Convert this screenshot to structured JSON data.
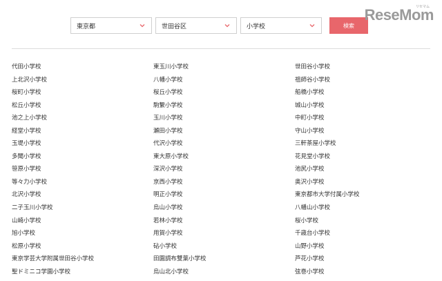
{
  "filters": {
    "prefecture": "東京都",
    "city": "世田谷区",
    "school_type": "小学校",
    "search_label": "検索"
  },
  "logo": {
    "text": "ReseMom",
    "ruby": "リセマム"
  },
  "columns": [
    [
      "代田小学校",
      "上北沢小学校",
      "桜町小学校",
      "松丘小学校",
      "池之上小学校",
      "経堂小学校",
      "玉堤小学校",
      "多聞小学校",
      "笹原小学校",
      "等々力小学校",
      "北沢小学校",
      "二子玉川小学校",
      "山崎小学校",
      "旭小学校",
      "松原小学校",
      "東京学芸大学附属世田谷小学校",
      "聖ドミニコ学園小学校"
    ],
    [
      "東玉川小学校",
      "八幡小学校",
      "桜丘小学校",
      "駒繋小学校",
      "玉川小学校",
      "瀬田小学校",
      "代沢小学校",
      "東大原小学校",
      "深沢小学校",
      "京西小学校",
      "明正小学校",
      "烏山小学校",
      "若林小学校",
      "用賀小学校",
      "砧小学校",
      "田園調布雙葉小学校",
      "烏山北小学校"
    ],
    [
      "世田谷小学校",
      "祖師谷小学校",
      "船橋小学校",
      "城山小学校",
      "中町小学校",
      "守山小学校",
      "三軒茶屋小学校",
      "花見堂小学校",
      "池尻小学校",
      "奥沢小学校",
      "東京都市大学付属小学校",
      "八幡山小学校",
      "桜小学校",
      "千歳台小学校",
      "山野小学校",
      "芦花小学校",
      "弦巻小学校"
    ]
  ]
}
